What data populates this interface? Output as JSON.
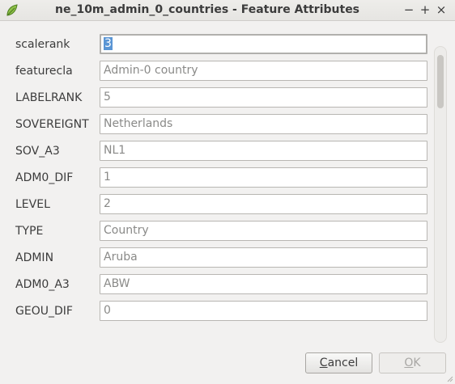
{
  "window": {
    "title": "ne_10m_admin_0_countries - Feature Attributes",
    "minimize_glyph": "−",
    "maximize_glyph": "+",
    "close_glyph": "×",
    "app_icon": "qgis-leaf-icon"
  },
  "fields": [
    {
      "label": "scalerank",
      "value": "3",
      "focused": true
    },
    {
      "label": "featurecla",
      "value": "Admin-0 country"
    },
    {
      "label": "LABELRANK",
      "value": "5"
    },
    {
      "label": "SOVEREIGNT",
      "value": "Netherlands"
    },
    {
      "label": "SOV_A3",
      "value": "NL1"
    },
    {
      "label": "ADM0_DIF",
      "value": "1"
    },
    {
      "label": "LEVEL",
      "value": "2"
    },
    {
      "label": "TYPE",
      "value": "Country"
    },
    {
      "label": "ADMIN",
      "value": "Aruba"
    },
    {
      "label": "ADM0_A3",
      "value": "ABW"
    },
    {
      "label": "GEOU_DIF",
      "value": "0"
    }
  ],
  "buttons": {
    "cancel_prefix": "",
    "cancel_mnemonic": "C",
    "cancel_rest": "ancel",
    "ok_prefix": "",
    "ok_mnemonic": "O",
    "ok_rest": "K"
  },
  "colors": {
    "selection": "#5a95d4",
    "window_bg": "#f2f1f0"
  }
}
